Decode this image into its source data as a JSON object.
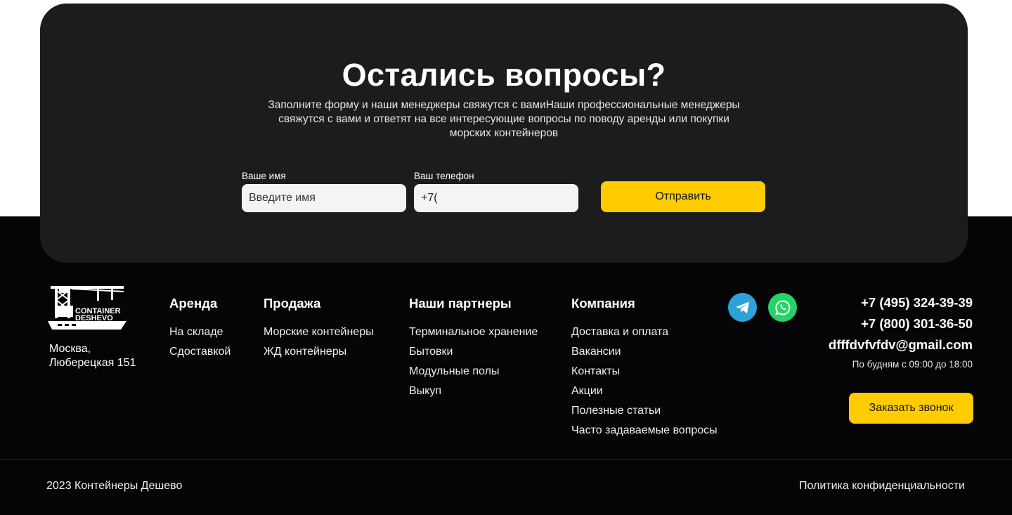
{
  "cta": {
    "title": "Остались вопросы?",
    "description": "Заполните форму и наши менеджеры свяжутся с вамиНаши профессиональные менеджеры свяжутся с вами и ответят на все интересующие вопросы по поводу аренды или покупки морских контейнеров",
    "name_label": "Ваше имя",
    "name_placeholder": "Введите имя",
    "phone_label": "Ваш телефон",
    "phone_value": "+7(",
    "submit_label": "Отправить"
  },
  "logo": {
    "line1": "CONTAINER",
    "line2": "DESHEVO"
  },
  "address": {
    "line1": "Москва,",
    "line2": "Люберецкая 151"
  },
  "columns": [
    {
      "title": "Аренда",
      "items": [
        "На складе",
        "Сдоставкой"
      ]
    },
    {
      "title": "Продажа",
      "items": [
        "Морские контейнеры",
        "ЖД контейнеры"
      ]
    },
    {
      "title": "Наши партнеры",
      "items": [
        "Терминальное хранение",
        "Бытовки",
        "Модульные полы",
        "Выкуп"
      ]
    },
    {
      "title": "Компания",
      "items": [
        "Доставка и оплата",
        "Вакансии",
        "Контакты",
        "Акции",
        "Полезные статьи",
        "Часто задаваемые вопросы"
      ]
    }
  ],
  "social": [
    {
      "icon": "telegram-icon",
      "color": "#2ca3d8"
    },
    {
      "icon": "whatsapp-icon",
      "color": "#25d366"
    }
  ],
  "contacts": {
    "phone1": "+7 (495) 324-39-39",
    "phone2": "+7 (800) 301-36-50",
    "email": "dfffdvfvfdv@gmail.com",
    "hours": "По будням с 09:00 до 18:00",
    "callback_label": "Заказать звонок"
  },
  "bottom": {
    "copyright": "2023 Контейнеры Дешево",
    "policy": "Политика конфиденциальности"
  },
  "colors": {
    "accent": "#ffcc00",
    "card": "#1c1c1c",
    "footer": "#050507"
  }
}
